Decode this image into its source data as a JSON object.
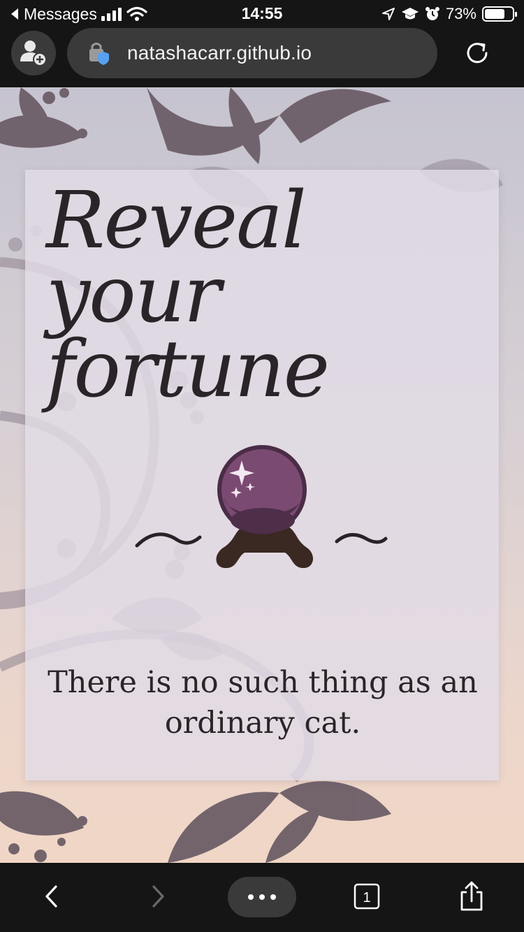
{
  "status_bar": {
    "back_app": "Messages",
    "time": "14:55",
    "battery_percent": "73%",
    "battery_level": 0.73,
    "icons": [
      "back-triangle-icon",
      "signal-icon",
      "wifi-icon",
      "location-icon",
      "graduation-cap-icon",
      "alarm-icon",
      "battery-icon"
    ]
  },
  "browser": {
    "url": "natashacarr.github.io",
    "icons": [
      "add-profile-icon",
      "lock-shield-icon",
      "reload-icon"
    ]
  },
  "page": {
    "title": "Reveal your fortune",
    "fortune": "There is no such thing as an ordinary cat.",
    "icons": [
      "crystal-ball-icon",
      "tilde-flourish-icon"
    ],
    "colors": {
      "orb": "#7b4a72",
      "orb_dark": "#4e2f49",
      "stand": "#3a2822",
      "text": "#2a2428"
    }
  },
  "toolbar": {
    "tab_count": "1",
    "icons": [
      "back-chevron-icon",
      "forward-chevron-icon",
      "more-dots-icon",
      "tabs-icon",
      "share-icon"
    ]
  }
}
